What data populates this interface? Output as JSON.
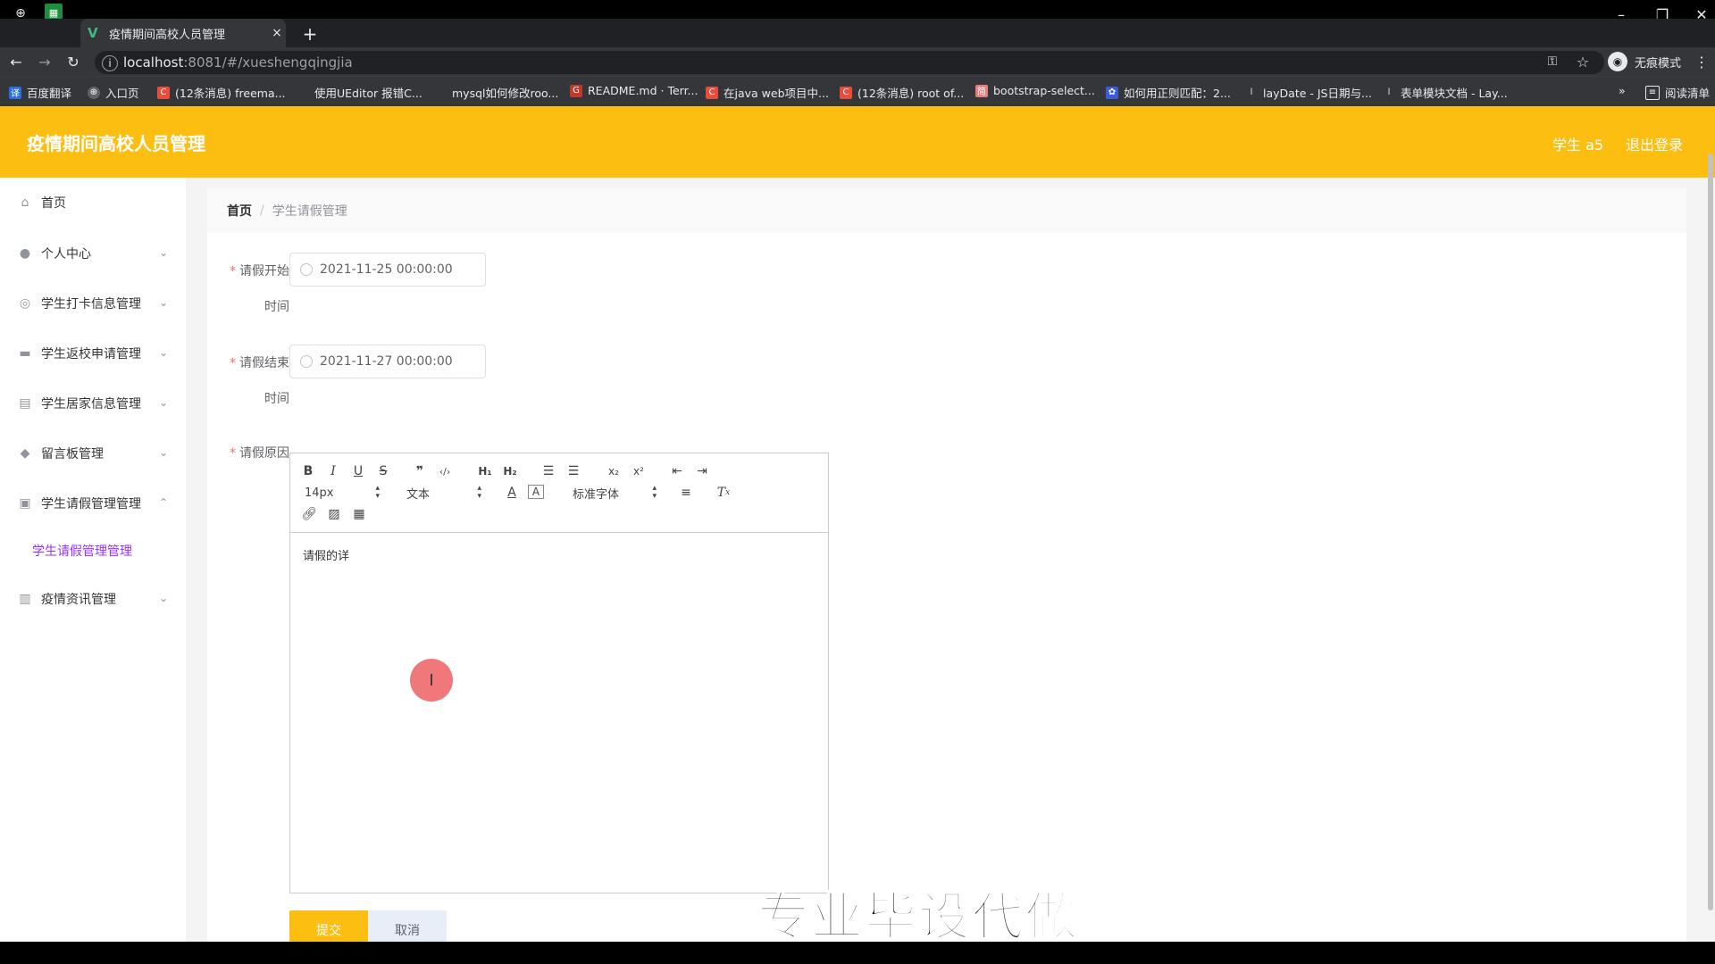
{
  "browser": {
    "tab_title": "疫情期间高校人员管理",
    "tab_close": "×",
    "new_tab": "+",
    "url_host": "localhost",
    "url_path": ":8081/#/xueshengqingjia",
    "incognito_label": "无痕模式",
    "bookmarks": [
      "百度翻译",
      "入口页",
      "(12条消息) freema...",
      "使用UEditor 报错C...",
      "mysql如何修改roo...",
      "README.md · Terr...",
      "在java web项目中...",
      "(12条消息) root of...",
      "bootstrap-select...",
      "如何用正则匹配：2...",
      "layDate - JS日期与...",
      "表单模块文档 - Lay..."
    ],
    "bookmarks_overflow": "»",
    "reading_list": "阅读清单"
  },
  "header": {
    "title": "疫情期间高校人员管理",
    "user": "学生 a5",
    "logout": "退出登录",
    "color": "#fdbe12"
  },
  "sidebar": {
    "items": [
      {
        "label": "首页",
        "icon": "home-icon"
      },
      {
        "label": "个人中心",
        "icon": "user-icon"
      },
      {
        "label": "学生打卡信息管理",
        "icon": "circle-icon"
      },
      {
        "label": "学生返校申请管理",
        "icon": "briefcase-icon"
      },
      {
        "label": "学生居家信息管理",
        "icon": "chart-icon"
      },
      {
        "label": "留言板管理",
        "icon": "location-icon"
      },
      {
        "label": "学生请假管理管理",
        "icon": "clipboard-icon"
      },
      {
        "label": "疫情资讯管理",
        "icon": "bank-icon"
      }
    ],
    "active_sub": "学生请假管理管理"
  },
  "breadcrumb": {
    "home": "首页",
    "separator": "/",
    "current": "学生请假管理"
  },
  "form": {
    "start_label_1": "请假开始",
    "start_label_2": "时间",
    "start_value": "2021-11-25 00:00:00",
    "end_label_1": "请假结束",
    "end_label_2": "时间",
    "end_value": "2021-11-27 00:00:00",
    "reason_label": "请假原因",
    "required_mark": "*",
    "reason_content": "请假的详",
    "submit": "提交",
    "cancel": "取消"
  },
  "editor_toolbar": {
    "size": "14px",
    "header": "文本",
    "font": "标准字体"
  },
  "watermark": "专业毕设代做"
}
